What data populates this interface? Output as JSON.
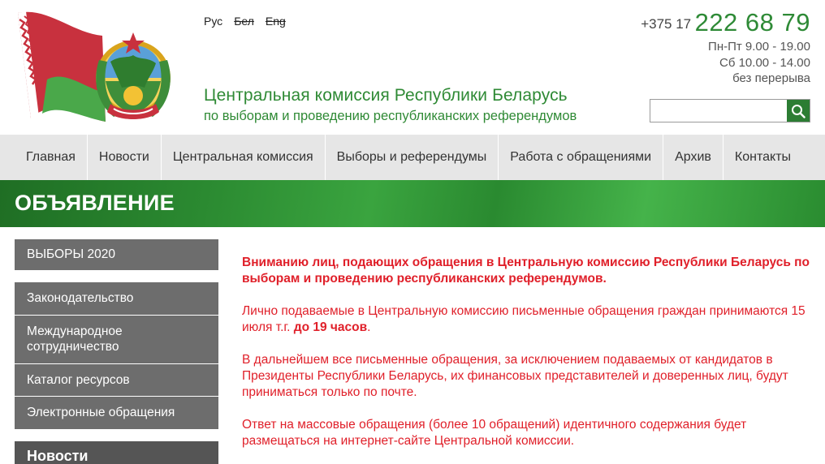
{
  "header": {
    "languages": [
      {
        "label": "Рус",
        "active": true
      },
      {
        "label": "Бел",
        "active": false
      },
      {
        "label": "Eng",
        "active": false
      }
    ],
    "title_line1": "Центральная комиссия Республики Беларусь",
    "title_line2": "по выборам и проведению республиканских референдумов",
    "phone_code": "+375 17",
    "phone_number": "222 68 79",
    "hours": [
      "Пн-Пт 9.00 - 19.00",
      "Сб 10.00 - 14.00",
      "без перерыва"
    ],
    "search": {
      "placeholder": "",
      "value": ""
    }
  },
  "nav": {
    "items": [
      "Главная",
      "Новости",
      "Центральная комиссия",
      "Выборы и референдумы",
      "Работа с обращениями",
      "Архив",
      "Контакты"
    ]
  },
  "banner": {
    "title": "ОБЪЯВЛЕНИЕ"
  },
  "sidebar": {
    "elections": "ВЫБОРЫ 2020",
    "items": [
      "Законодательство",
      "Международное сотрудничество",
      "Каталог ресурсов",
      "Электронные обращения"
    ],
    "news": "Новости"
  },
  "content": {
    "lead": "Вниманию лиц, подающих обращения в Центральную комиссию Республики Беларусь по выборам и проведению республиканских референдумов.",
    "p1_text": "Лично подаваемые в Центральную комиссию письменные обращения граждан принимаются 15 июля т.г. ",
    "p1_bold": "до 19 часов",
    "p1_end": ".",
    "p2": "В дальнейшем все письменные обращения, за исключением подаваемых от кандидатов в Президенты Республики Беларусь, их финансовых представителей и доверенных лиц, будут приниматься только по почте.",
    "p3": "Ответ на массовые обращения (более 10 обращений) идентичного содержания будет размещаться на интернет-сайте Центральной комиссии."
  },
  "colors": {
    "brand_green": "#2e8a36",
    "alert_red": "#e0202a",
    "sidebar_gray": "#6d6d6d",
    "nav_gray": "#e6e6e6"
  }
}
